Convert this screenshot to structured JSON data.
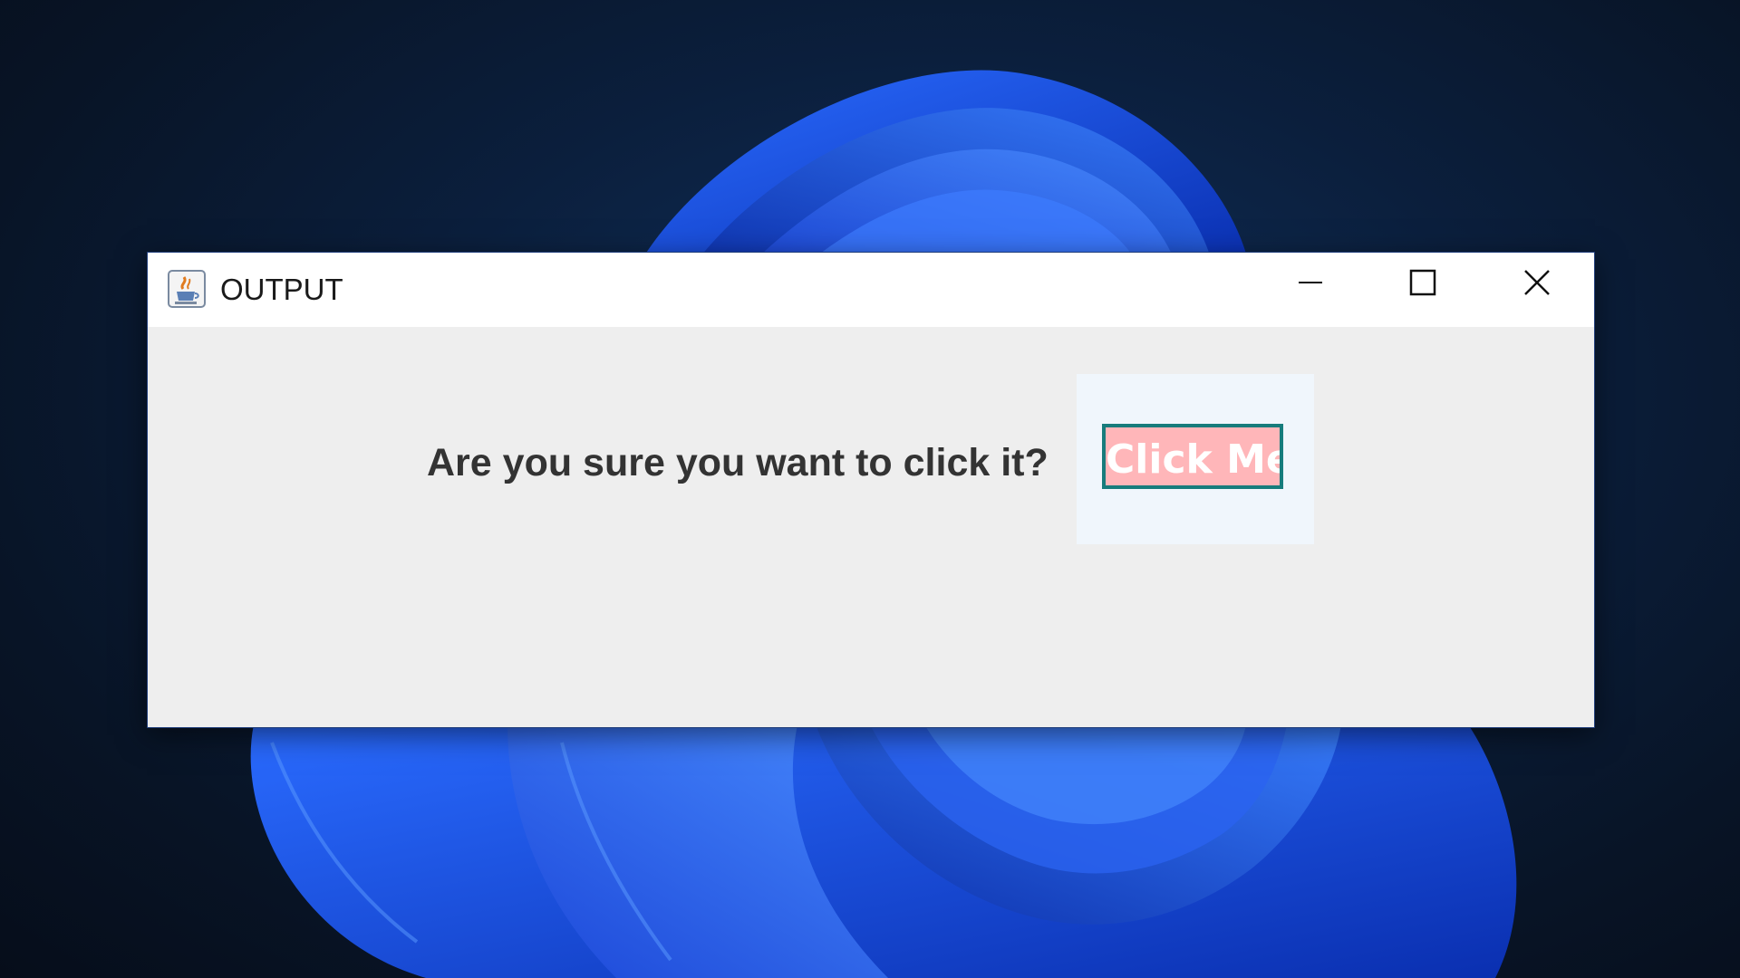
{
  "window": {
    "title": "OUTPUT",
    "icon": "java-cup-icon"
  },
  "controls": {
    "minimize_icon": "minimize-icon",
    "maximize_icon": "maximize-icon",
    "close_icon": "close-icon"
  },
  "content": {
    "prompt": "Are you sure you want to click it?",
    "button_label": "Click Me"
  },
  "colors": {
    "button_background": "#ffb6b9",
    "button_border": "#177c7c",
    "button_text": "#ffffff",
    "window_background": "#eeeeee",
    "desktop_background": "#0b1f3d",
    "wallpaper_accent": "#1e4fe0"
  }
}
